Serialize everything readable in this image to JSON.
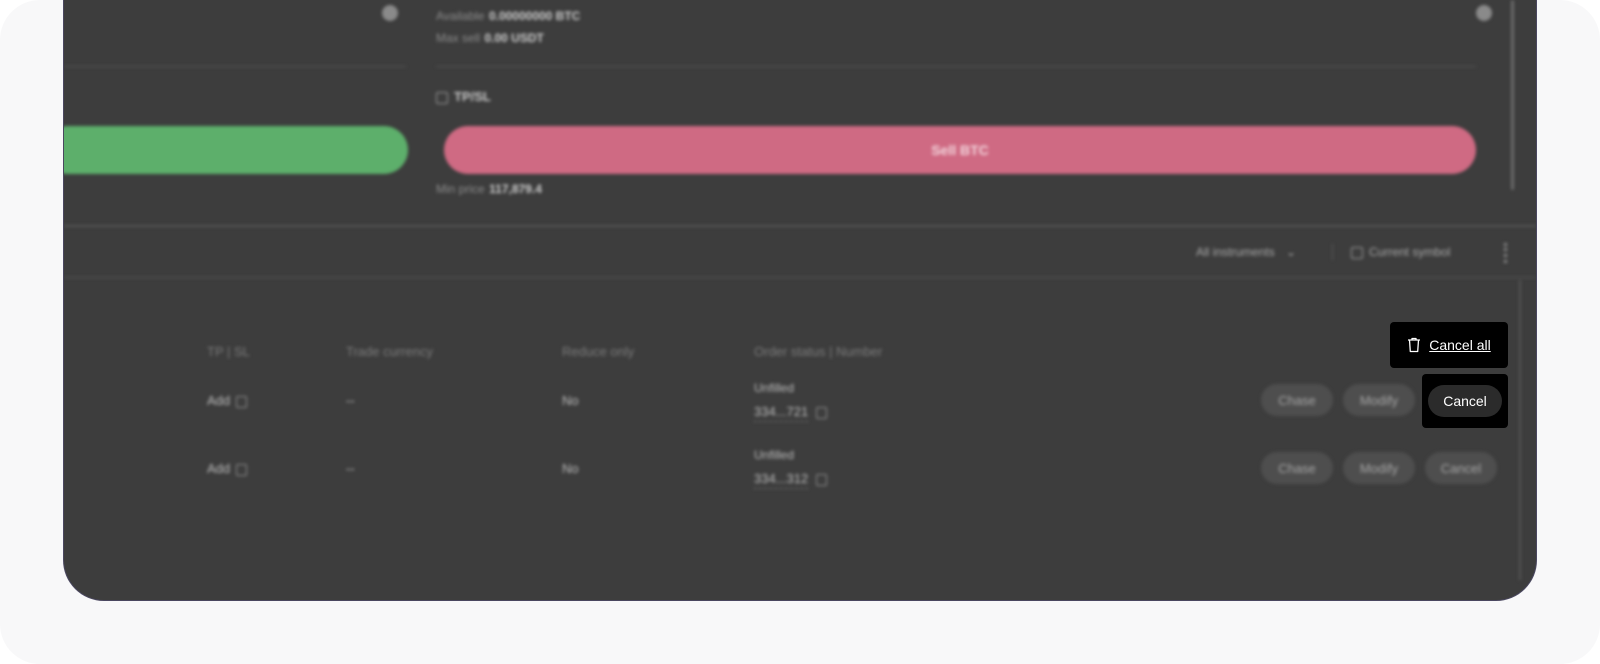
{
  "order_form": {
    "available_label": "Available",
    "available_value": "0.00000000 BTC",
    "max_sell_label": "Max sell",
    "max_sell_value": "0.00 USDT",
    "tpsl_label": "TP/SL",
    "sell_button": "Sell BTC",
    "min_price_label": "Min price",
    "min_price_value": "117,879.4"
  },
  "filters": {
    "instruments_label": "All instruments",
    "current_symbol_label": "Current symbol"
  },
  "orders_table": {
    "columns": [
      "TP | SL",
      "Trade currency",
      "Reduce only",
      "Order status | Number"
    ],
    "rows": [
      {
        "tpsl": "Add",
        "trade_currency": "--",
        "reduce_only": "No",
        "status": "Unfilled",
        "number": "334...721"
      },
      {
        "tpsl": "Add",
        "trade_currency": "--",
        "reduce_only": "No",
        "status": "Unfilled",
        "number": "334...312"
      }
    ],
    "row_actions": {
      "chase": "Chase",
      "modify": "Modify",
      "cancel": "Cancel"
    }
  },
  "callouts": {
    "cancel_all": "Cancel all",
    "cancel": "Cancel"
  },
  "icons": {
    "info": "info-icon",
    "copy": "copy-icon",
    "trash": "trash-icon",
    "chevron": "chevron-down-icon"
  },
  "colors": {
    "buy": "#5daf6b",
    "sell": "#cf6a83",
    "panel": "#3d3d3d",
    "callout": "#000000"
  }
}
